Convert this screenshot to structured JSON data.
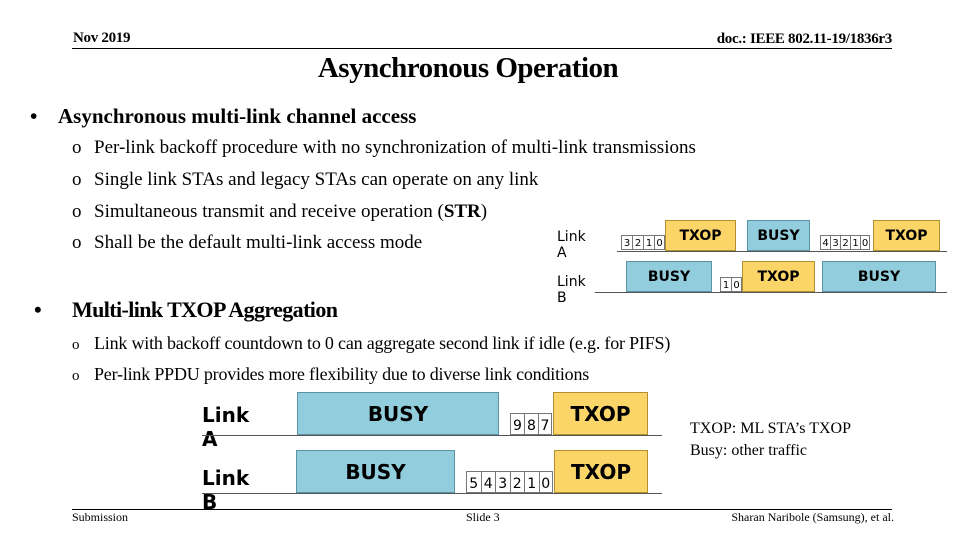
{
  "header": {
    "date": "Nov 2019",
    "doc_id": "doc.: IEEE 802.11-19/1836r3"
  },
  "title": "Asynchronous Operation",
  "sections": [
    {
      "heading": "Asynchronous multi-link channel access",
      "bullet": "•",
      "items": [
        {
          "text": "Per-link backoff procedure with no synchronization of multi-link transmissions"
        },
        {
          "text": "Single link STAs and legacy STAs can operate on any link"
        },
        {
          "text_before": "Simultaneous transmit and receive operation (",
          "text_bold": "STR",
          "text_after": ")"
        },
        {
          "text": "Shall be the default multi-link access mode"
        }
      ]
    },
    {
      "heading": "Multi-link TXOP Aggregation",
      "bullet": "•",
      "items": [
        {
          "text": "Link with backoff countdown to 0 can aggregate second link if idle (e.g. for PIFS)"
        },
        {
          "text": "Per-link PPDU provides more flexibility due to diverse link conditions"
        }
      ]
    }
  ],
  "sub_bullet": "o",
  "diagram1": {
    "links": [
      {
        "label": "Link A",
        "segments": [
          {
            "type": "counter",
            "values": [
              "3",
              "2",
              "1",
              "0"
            ]
          },
          {
            "type": "txop",
            "label": "TXOP"
          },
          {
            "type": "busy",
            "label": "BUSY"
          },
          {
            "type": "counter",
            "values": [
              "4",
              "3",
              "2",
              "1",
              "0"
            ]
          },
          {
            "type": "txop",
            "label": "TXOP"
          }
        ]
      },
      {
        "label": "Link B",
        "segments": [
          {
            "type": "busy",
            "label": "BUSY"
          },
          {
            "type": "counter",
            "values": [
              "1",
              "0"
            ]
          },
          {
            "type": "txop",
            "label": "TXOP"
          },
          {
            "type": "busy",
            "label": "BUSY"
          }
        ]
      }
    ]
  },
  "diagram2": {
    "links": [
      {
        "label": "Link A",
        "segments": [
          {
            "type": "busy",
            "label": "BUSY"
          },
          {
            "type": "counter",
            "values": [
              "9",
              "8",
              "7"
            ]
          },
          {
            "type": "txop",
            "label": "TXOP"
          }
        ]
      },
      {
        "label": "Link B",
        "segments": [
          {
            "type": "busy",
            "label": "BUSY"
          },
          {
            "type": "counter",
            "values": [
              "5",
              "4",
              "3",
              "2",
              "1",
              "0"
            ]
          },
          {
            "type": "txop",
            "label": "TXOP"
          }
        ]
      }
    ]
  },
  "legend": {
    "line1": "TXOP: ML STA’s TXOP",
    "line2": "Busy: other traffic"
  },
  "colors": {
    "txop": "#fbd567",
    "busy": "#91cddc"
  },
  "footer": {
    "left": "Submission",
    "center": "Slide 3",
    "right": "Sharan Naribole (Samsung), et al."
  }
}
